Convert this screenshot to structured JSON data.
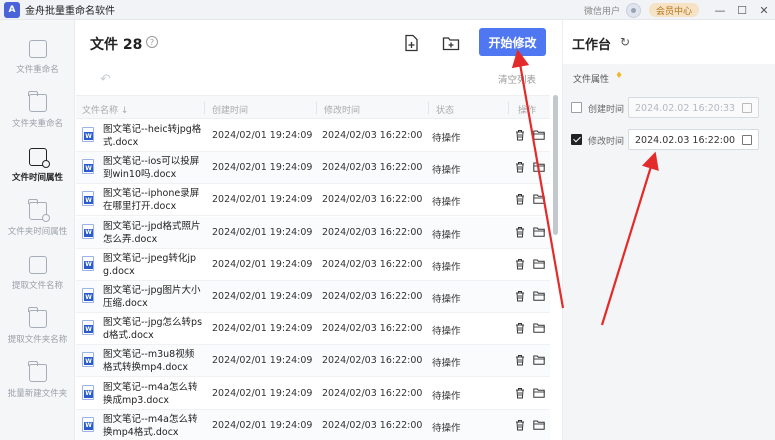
{
  "window": {
    "app_title": "金舟批量重命名软件",
    "logo_text": "A",
    "user_label": "微信用户",
    "vip_label": "会员中心",
    "minimize": "—",
    "maximize": "☐",
    "close": "✕"
  },
  "sidebar": {
    "items": [
      {
        "label": "文件重命名",
        "icon": "file-rename-icon"
      },
      {
        "label": "文件夹重命名",
        "icon": "folder-rename-icon"
      },
      {
        "label": "文件时间属性",
        "icon": "file-time-icon",
        "active": true
      },
      {
        "label": "文件夹时间属性",
        "icon": "folder-time-icon"
      },
      {
        "label": "提取文件名称",
        "icon": "extract-file-name-icon"
      },
      {
        "label": "提取文件夹名称",
        "icon": "extract-folder-name-icon"
      },
      {
        "label": "批量新建文件夹",
        "icon": "batch-new-folder-icon"
      }
    ]
  },
  "main": {
    "title": "文件 28",
    "help": "?",
    "start_button": "开始修改",
    "undo": "↶",
    "clear_list": "清空列表",
    "columns": [
      "文件名称",
      "创建时间",
      "修改时间",
      "状态",
      "操作"
    ],
    "sort_arrow": "↓",
    "rows": [
      {
        "name": "图文笔记--heic转jpg格式.docx",
        "created": "2024/02/01 19:24:09",
        "modified": "2024/02/03 16:22:00",
        "status": "待操作"
      },
      {
        "name": "图文笔记--ios可以投屏到win10吗.docx",
        "created": "2024/02/01 19:24:09",
        "modified": "2024/02/03 16:22:00",
        "status": "待操作"
      },
      {
        "name": "图文笔记--iphone录屏在哪里打开.docx",
        "created": "2024/02/01 19:24:09",
        "modified": "2024/02/03 16:22:00",
        "status": "待操作"
      },
      {
        "name": "图文笔记--jpd格式照片怎么弄.docx",
        "created": "2024/02/01 19:24:09",
        "modified": "2024/02/03 16:22:00",
        "status": "待操作"
      },
      {
        "name": "图文笔记--jpeg转化jpg.docx",
        "created": "2024/02/01 19:24:09",
        "modified": "2024/02/03 16:22:00",
        "status": "待操作"
      },
      {
        "name": "图文笔记--jpg图片大小压缩.docx",
        "created": "2024/02/01 19:24:09",
        "modified": "2024/02/03 16:22:00",
        "status": "待操作"
      },
      {
        "name": "图文笔记--jpg怎么转psd格式.docx",
        "created": "2024/02/01 19:24:09",
        "modified": "2024/02/03 16:22:00",
        "status": "待操作"
      },
      {
        "name": "图文笔记--m3u8视频格式转换mp4.docx",
        "created": "2024/02/01 19:24:09",
        "modified": "2024/02/03 16:22:00",
        "status": "待操作"
      },
      {
        "name": "图文笔记--m4a怎么转换成mp3.docx",
        "created": "2024/02/01 19:24:09",
        "modified": "2024/02/03 16:22:00",
        "status": "待操作"
      },
      {
        "name": "图文笔记--m4a怎么转换mp4格式.docx",
        "created": "2024/02/01 19:24:09",
        "modified": "2024/02/03 16:22:00",
        "status": "待操作"
      }
    ]
  },
  "workbench": {
    "title": "工作台",
    "refresh": "↻",
    "section_label": "文件属性",
    "vip_diamond": "♦",
    "created_label": "创建时间",
    "created_value": "2024.02.02 16:20:33",
    "created_checked": false,
    "modified_label": "修改时间",
    "modified_value": "2024.02.03 16:22:00",
    "modified_checked": true
  },
  "colors": {
    "accent": "#4f77f2",
    "annotation_arrow": "#e32b2b",
    "vip_bg": "#f6e2c4",
    "vip_text": "#b3741c"
  }
}
